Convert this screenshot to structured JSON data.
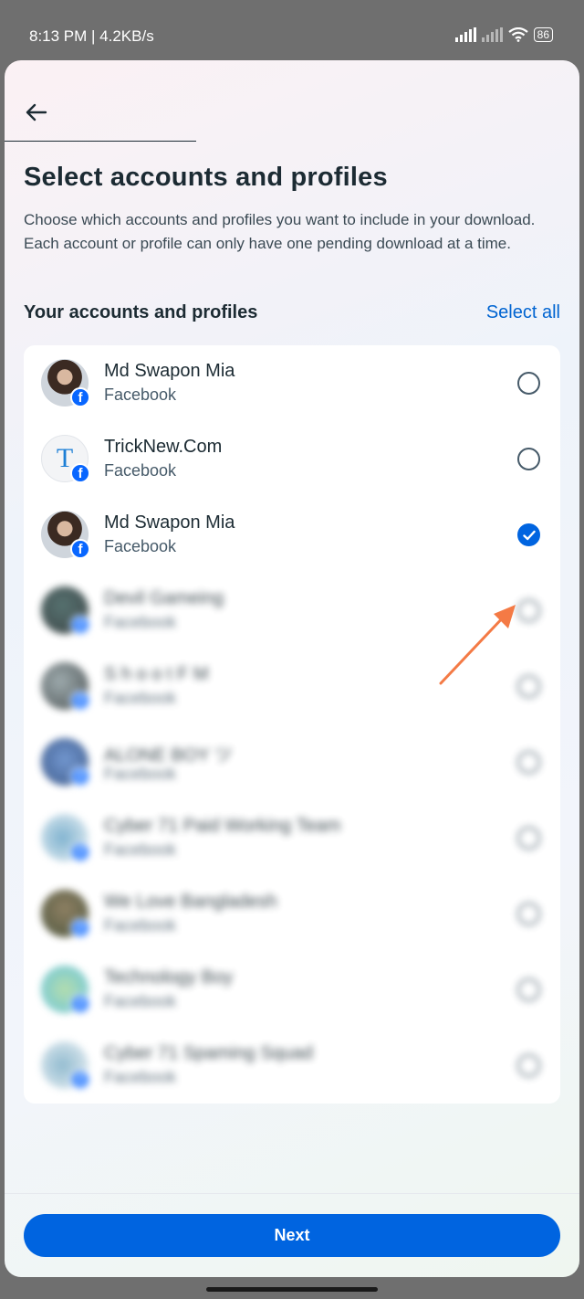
{
  "status_bar": {
    "time_speed": "8:13 PM | 4.2KB/s",
    "battery": "86"
  },
  "header": {
    "title": "Select accounts and profiles",
    "description": "Choose which accounts and profiles you want to include in your download. Each account or profile can only have one pending download at a time."
  },
  "section": {
    "label": "Your accounts and profiles",
    "select_all": "Select all"
  },
  "accounts": [
    {
      "name": "Md Swapon Mia",
      "platform": "Facebook",
      "selected": false
    },
    {
      "name": "TrickNew.Com",
      "platform": "Facebook",
      "selected": false
    },
    {
      "name": "Md Swapon Mia",
      "platform": "Facebook",
      "selected": true
    },
    {
      "name": "Devil Gameing",
      "platform": "Facebook",
      "selected": false
    },
    {
      "name": "S h o o t    F M",
      "platform": "Facebook",
      "selected": false
    },
    {
      "name": "ALONE BOY ツ",
      "platform": "Facebook",
      "selected": false
    },
    {
      "name": "Cyber 71 Paid Working Team",
      "platform": "Facebook",
      "selected": false
    },
    {
      "name": "We Love Bangladesh",
      "platform": "Facebook",
      "selected": false
    },
    {
      "name": "Technology Boy",
      "platform": "Facebook",
      "selected": false
    },
    {
      "name": "Cyber 71 Spaming Squad",
      "platform": "Facebook",
      "selected": false
    }
  ],
  "avatar_letter": "T",
  "footer": {
    "next_label": "Next"
  },
  "colors": {
    "accent": "#0064e0",
    "facebook": "#0866ff",
    "annotation_arrow": "#f47a45"
  }
}
